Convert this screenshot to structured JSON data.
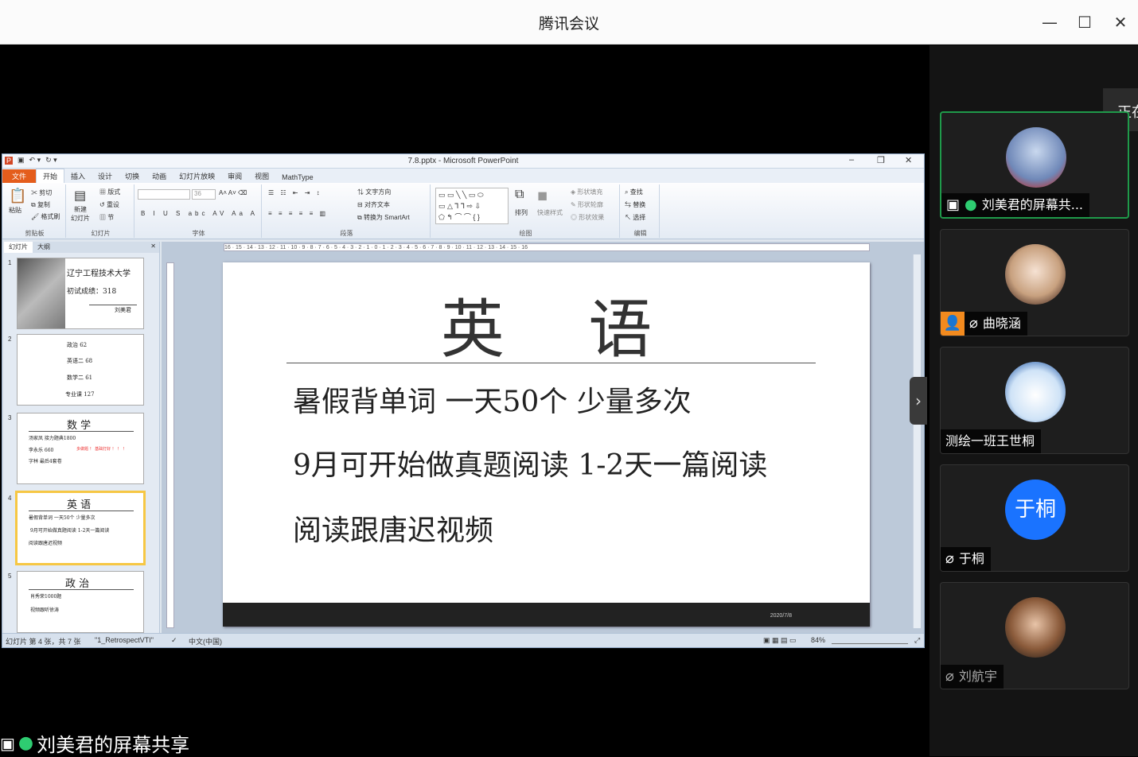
{
  "window": {
    "title": "腾讯会议"
  },
  "floating_tab": {
    "label": "正在"
  },
  "participants": [
    {
      "name": "刘美君的屏幕共...",
      "mic": "on",
      "avatar": "photo-girl"
    },
    {
      "name": "曲晓涵",
      "mic": "muted",
      "avatar": "anime-girl"
    },
    {
      "name": "测绘一班王世桐",
      "mic": "none",
      "avatar": "cartoon-boy"
    },
    {
      "name": "于桐",
      "mic": "muted",
      "avatar": "text",
      "avatar_text": "于桐"
    },
    {
      "name": "刘航宇",
      "mic": "muted",
      "avatar": "photo-selfie"
    }
  ],
  "share_label": "刘美君的屏幕共享",
  "ppt": {
    "title": "7.8.pptx - Microsoft PowerPoint",
    "tabs": [
      "文件",
      "开始",
      "插入",
      "设计",
      "切换",
      "动画",
      "幻灯片放映",
      "审阅",
      "视图",
      "MathType"
    ],
    "groups": {
      "clipboard": {
        "label": "剪贴板",
        "paste": "粘贴",
        "cut": "剪切",
        "copy": "复制",
        "format": "格式刷"
      },
      "slides": {
        "label": "幻灯片",
        "new": "新建",
        "new2": "幻灯片",
        "layout": "版式",
        "reset": "重设",
        "section": "节"
      },
      "font": {
        "label": "字体",
        "size": "36"
      },
      "paragraph": {
        "label": "段落",
        "text_dir": "文字方向",
        "align": "对齐文本",
        "smartart": "转换为 SmartArt"
      },
      "drawing": {
        "label": "绘图",
        "arrange": "排列",
        "quick": "快速样式",
        "fill": "形状填充",
        "outline": "形状轮廓",
        "effect": "形状效果"
      },
      "editing": {
        "label": "编辑",
        "find": "查找",
        "replace": "替换",
        "select": "选择"
      }
    },
    "panel_tabs": [
      "幻灯片",
      "大纲"
    ],
    "thumbnails": [
      {
        "num": "1",
        "lines": [
          "辽宁工程技术大学",
          "初试成绩：318",
          "刘美君"
        ]
      },
      {
        "num": "2",
        "lines": [
          "政治  62",
          "英语二  68",
          "数学二  61",
          "专业课  127"
        ]
      },
      {
        "num": "3",
        "title": "数 学",
        "lines": [
          "汤家凤  接力题典1800",
          "李永乐  660",
          "字林  最后4套卷"
        ],
        "red": "多做题 ！ 基础打好 ！ ！ ！"
      },
      {
        "num": "4",
        "title": "英 语",
        "lines": [
          "暑假背单词  一天50个  少量多次",
          "9月可开始做真题阅读  1-2天一篇阅读",
          "阅读跟唐迟视频"
        ]
      },
      {
        "num": "5",
        "title": "政 治",
        "lines": [
          "肖秀荣1000题",
          "视频跟听徐涛"
        ]
      }
    ],
    "slide": {
      "title": "英 语",
      "lines": [
        "暑假背单词  一天50个  少量多次",
        "9月可开始做真题阅读  1-2天一篇阅读",
        "阅读跟唐迟视频"
      ],
      "date": "2020/7/8"
    },
    "status": {
      "slide_info": "幻灯片 第 4 张，共 7 张",
      "theme": "\"1_RetrospectVTI\"",
      "lang": "中文(中国)",
      "zoom": "84%"
    },
    "ruler_text": "16 · 15 · 14 · 13 · 12 · 11 · 10 · 9 · 8 · 7 · 6 · 5 · 4 · 3 · 2 · 1 · 0 · 1 · 2 · 3 · 4 · 5 · 6 · 7 · 8 · 9 · 10 · 11 · 12 · 13 · 14 · 15 · 16"
  },
  "colors": {
    "accent_green": "#1f9a4a",
    "file_tab": "#e45d1c",
    "blue_avatar": "#1a73ff"
  }
}
